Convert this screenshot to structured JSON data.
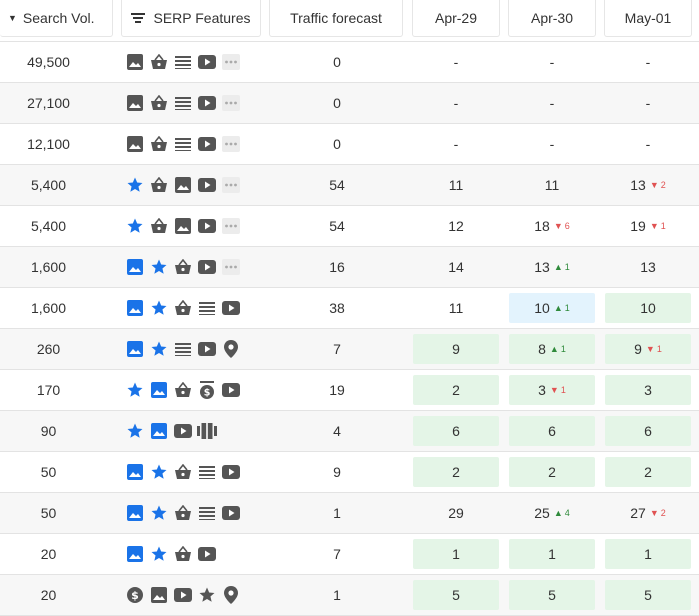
{
  "headers": {
    "search_vol": "Search Vol.",
    "serp_features": "SERP Features",
    "traffic_forecast": "Traffic forecast",
    "date1": "Apr-29",
    "date2": "Apr-30",
    "date3": "May-01"
  },
  "colors": {
    "blue": "#1a73e8",
    "gray": "#555555",
    "up": "#2f8a3b",
    "down": "#e05252",
    "green_cell": "#e4f5e7",
    "blue_cell": "#e3f3fd"
  },
  "rows": [
    {
      "vol": "49,500",
      "icons": [
        "image",
        "basket",
        "list",
        "video",
        "more"
      ],
      "traffic": "0",
      "d": [
        {
          "v": "-"
        },
        {
          "v": "-"
        },
        {
          "v": "-"
        }
      ]
    },
    {
      "vol": "27,100",
      "icons": [
        "image",
        "basket",
        "list",
        "video",
        "more"
      ],
      "traffic": "0",
      "d": [
        {
          "v": "-"
        },
        {
          "v": "-"
        },
        {
          "v": "-"
        }
      ]
    },
    {
      "vol": "12,100",
      "icons": [
        "image",
        "basket",
        "list",
        "video",
        "more"
      ],
      "traffic": "0",
      "d": [
        {
          "v": "-"
        },
        {
          "v": "-"
        },
        {
          "v": "-"
        }
      ]
    },
    {
      "vol": "5,400",
      "icons": [
        "star-blue",
        "basket",
        "image",
        "video",
        "more"
      ],
      "traffic": "54",
      "d": [
        {
          "v": "11"
        },
        {
          "v": "11"
        },
        {
          "v": "13",
          "ch": "2",
          "dir": "down"
        }
      ]
    },
    {
      "vol": "5,400",
      "icons": [
        "star-blue",
        "basket",
        "image",
        "video",
        "more"
      ],
      "traffic": "54",
      "d": [
        {
          "v": "12"
        },
        {
          "v": "18",
          "ch": "6",
          "dir": "down"
        },
        {
          "v": "19",
          "ch": "1",
          "dir": "down"
        }
      ]
    },
    {
      "vol": "1,600",
      "icons": [
        "image-blue",
        "star-blue",
        "basket",
        "video",
        "more"
      ],
      "traffic": "16",
      "d": [
        {
          "v": "14"
        },
        {
          "v": "13",
          "ch": "1",
          "dir": "up"
        },
        {
          "v": "13"
        }
      ]
    },
    {
      "vol": "1,600",
      "icons": [
        "image-blue",
        "star-blue",
        "basket",
        "list",
        "video"
      ],
      "traffic": "38",
      "d": [
        {
          "v": "11"
        },
        {
          "v": "10",
          "ch": "1",
          "dir": "up",
          "bg": "blue"
        },
        {
          "v": "10",
          "bg": "green"
        }
      ]
    },
    {
      "vol": "260",
      "icons": [
        "image-blue",
        "star-blue",
        "list",
        "video",
        "pin"
      ],
      "traffic": "7",
      "d": [
        {
          "v": "9",
          "bg": "green"
        },
        {
          "v": "8",
          "ch": "1",
          "dir": "up",
          "bg": "green"
        },
        {
          "v": "9",
          "ch": "1",
          "dir": "down",
          "bg": "green"
        }
      ]
    },
    {
      "vol": "170",
      "icons": [
        "star-blue",
        "image-blue",
        "basket",
        "dollar-list",
        "video"
      ],
      "traffic": "19",
      "d": [
        {
          "v": "2",
          "bg": "green"
        },
        {
          "v": "3",
          "ch": "1",
          "dir": "down",
          "bg": "green"
        },
        {
          "v": "3",
          "bg": "green"
        }
      ]
    },
    {
      "vol": "90",
      "icons": [
        "star-blue",
        "image-blue",
        "video",
        "carousel"
      ],
      "traffic": "4",
      "d": [
        {
          "v": "6",
          "bg": "green"
        },
        {
          "v": "6",
          "bg": "green"
        },
        {
          "v": "6",
          "bg": "green"
        }
      ]
    },
    {
      "vol": "50",
      "icons": [
        "image-blue",
        "star-blue",
        "basket",
        "list",
        "video"
      ],
      "traffic": "9",
      "d": [
        {
          "v": "2",
          "bg": "green"
        },
        {
          "v": "2",
          "bg": "green"
        },
        {
          "v": "2",
          "bg": "green"
        }
      ]
    },
    {
      "vol": "50",
      "icons": [
        "image-blue",
        "star-blue",
        "basket",
        "list",
        "video"
      ],
      "traffic": "1",
      "d": [
        {
          "v": "29"
        },
        {
          "v": "25",
          "ch": "4",
          "dir": "up"
        },
        {
          "v": "27",
          "ch": "2",
          "dir": "down"
        }
      ]
    },
    {
      "vol": "20",
      "icons": [
        "image-blue",
        "star-blue",
        "basket",
        "video"
      ],
      "traffic": "7",
      "d": [
        {
          "v": "1",
          "bg": "green"
        },
        {
          "v": "1",
          "bg": "green"
        },
        {
          "v": "1",
          "bg": "green"
        }
      ]
    },
    {
      "vol": "20",
      "icons": [
        "dollar",
        "image",
        "video",
        "star",
        "pin"
      ],
      "traffic": "1",
      "d": [
        {
          "v": "5",
          "bg": "green"
        },
        {
          "v": "5",
          "bg": "green"
        },
        {
          "v": "5",
          "bg": "green"
        }
      ]
    }
  ]
}
